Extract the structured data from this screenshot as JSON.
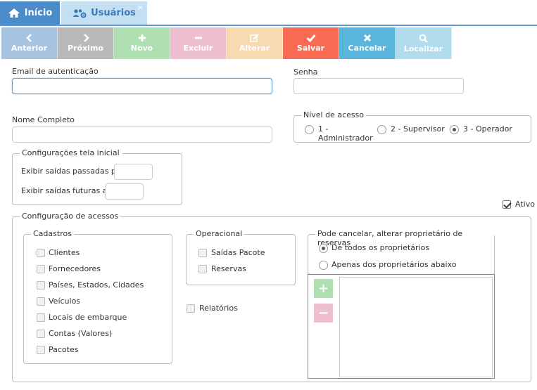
{
  "tabs": {
    "home": "Início",
    "users": "Usuários",
    "close": "×"
  },
  "toolbar": {
    "prev": "Anterior",
    "next": "Próximo",
    "new": "Novo",
    "delete": "Excluir",
    "edit": "Alterar",
    "save": "Salvar",
    "cancel": "Cancelar",
    "find": "Localizar"
  },
  "colors": {
    "prev": "#a6c4e0",
    "next": "#b9b9b9",
    "new": "#addfb0",
    "delete": "#eebfd1",
    "edit": "#f7dab0",
    "save": "#f96a53",
    "cancel": "#5ab5dc",
    "find": "#b0dcee"
  },
  "form": {
    "email_label": "Email de autenticação",
    "email_value": "",
    "password_label": "Senha",
    "password_value": "",
    "name_label": "Nome Completo",
    "name_value": ""
  },
  "access_level": {
    "legend": "Nível de acesso",
    "opt1": "1 -",
    "opt1b": "Administrador",
    "opt2": "2 - Supervisor",
    "opt3": "3 - Operador",
    "selected": "3"
  },
  "home_config": {
    "legend": "Configurações tela inicial",
    "past_label": "Exibir saídas passadas por",
    "past_value": "",
    "future_label": "Exibir saídas futuras até",
    "future_value": ""
  },
  "active_label": "Ativo",
  "access_config": {
    "legend": "Configuração de acessos",
    "cadastros": {
      "legend": "Cadastros",
      "items": [
        "Clientes",
        "Fornecedores",
        "Países, Estados, Cidades",
        "Veículos",
        "Locais de embarque",
        "Contas (Valores)",
        "Pacotes"
      ]
    },
    "operacional": {
      "legend": "Operacional",
      "items": [
        "Saídas Pacote",
        "Reservas"
      ]
    },
    "reports": "Relatórios",
    "reservations": {
      "legend": "Pode cancelar, alterar proprietário de reservas",
      "opt_all": "De todos os proprietários",
      "opt_some": "Apenas dos proprietários abaixo",
      "add": "+",
      "remove": "−"
    }
  }
}
